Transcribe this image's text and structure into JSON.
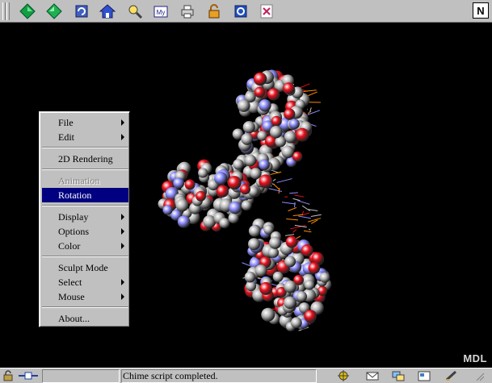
{
  "toolbar": {
    "icons": [
      "back-icon",
      "forward-icon",
      "reload-icon",
      "home-icon",
      "search-icon",
      "my-netscape-icon",
      "print-icon",
      "security-icon",
      "shop-icon",
      "stop-icon"
    ],
    "my_label": "My",
    "brand": "N"
  },
  "viewer": {
    "watermark": "MDL",
    "atom_colors": {
      "carbon": "#b8b8b8",
      "oxygen": "#e8101c",
      "nitrogen": "#8c8cff",
      "phosphorus": "#ff8c00"
    }
  },
  "context_menu": {
    "items": [
      {
        "label": "File",
        "submenu": true,
        "enabled": true,
        "selected": false
      },
      {
        "label": "Edit",
        "submenu": true,
        "enabled": true,
        "selected": false
      },
      {
        "label": "2D Rendering",
        "submenu": false,
        "enabled": true,
        "selected": false
      },
      {
        "label": "Animation",
        "submenu": false,
        "enabled": false,
        "selected": false
      },
      {
        "label": "Rotation",
        "submenu": false,
        "enabled": true,
        "selected": true
      },
      {
        "label": "Display",
        "submenu": true,
        "enabled": true,
        "selected": false
      },
      {
        "label": "Options",
        "submenu": true,
        "enabled": true,
        "selected": false
      },
      {
        "label": "Color",
        "submenu": true,
        "enabled": true,
        "selected": false
      },
      {
        "label": "Sculpt Mode",
        "submenu": false,
        "enabled": true,
        "selected": false
      },
      {
        "label": "Select",
        "submenu": true,
        "enabled": true,
        "selected": false
      },
      {
        "label": "Mouse",
        "submenu": true,
        "enabled": true,
        "selected": false
      },
      {
        "label": "About...",
        "submenu": false,
        "enabled": true,
        "selected": false
      }
    ]
  },
  "statusbar": {
    "message": "Chime script completed."
  }
}
